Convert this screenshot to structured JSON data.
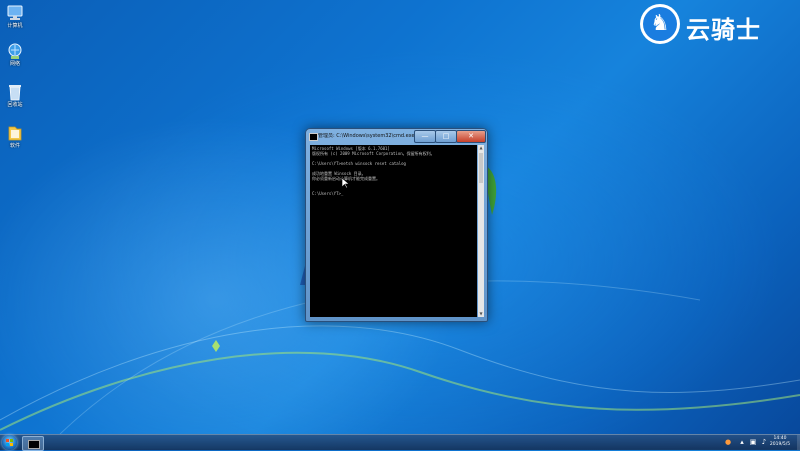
{
  "desktop": {
    "icons": [
      {
        "label": "计算机",
        "icon": "computer-icon"
      },
      {
        "label": "网络",
        "icon": "network-icon"
      },
      {
        "label": "回收站",
        "icon": "recycle-bin-icon"
      },
      {
        "label": "软件",
        "icon": "folder-icon"
      }
    ],
    "watermark": {
      "text": "云骑士",
      "emblem": "knight-icon"
    }
  },
  "cmd_window": {
    "title": "管理员: C:\\Windows\\system32\\cmd.exe",
    "controls": {
      "minimize": "—",
      "maximize": "□",
      "close": "✕"
    },
    "lines": [
      "Microsoft Windows [版本 6.1.7601]",
      "版权所有 (c) 2009 Microsoft Corporation。保留所有权利。",
      "",
      "C:\\Users\\YT>netsh winsock reset catalog",
      "",
      "成功地重置 Winsock 目录。",
      "你必须重新启动计算机才能完成重置。",
      "",
      "",
      "C:\\Users\\YT>_"
    ]
  },
  "taskbar": {
    "clock": {
      "time": "14:40",
      "date": "2019/5/5"
    }
  },
  "colors": {
    "desktop_blue": "#0e73d0",
    "console_bg": "#000000",
    "console_text": "#c0c0c0",
    "close_red": "#c6402a"
  }
}
